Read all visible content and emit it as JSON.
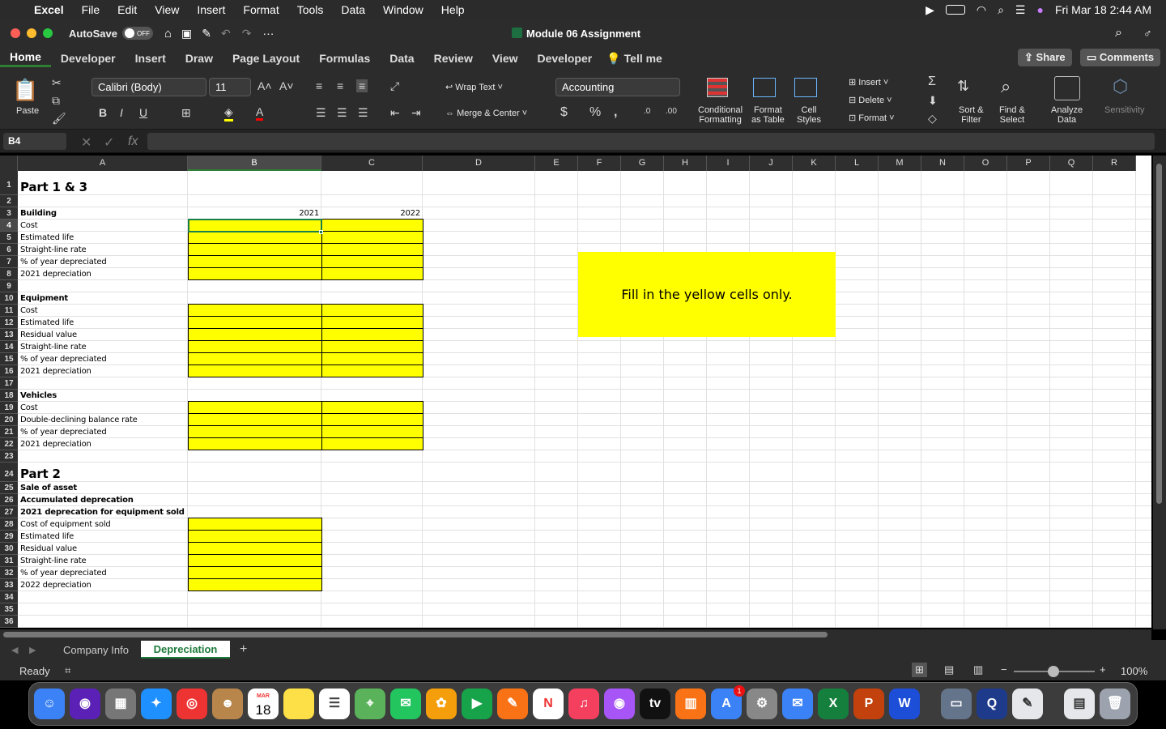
{
  "menubar": {
    "apple": "",
    "app": "Excel",
    "items": [
      "File",
      "Edit",
      "View",
      "Insert",
      "Format",
      "Tools",
      "Data",
      "Window",
      "Help"
    ],
    "datetime": "Fri Mar 18  2:44 AM"
  },
  "titlebar": {
    "autosave": "AutoSave",
    "autosave_state": "OFF",
    "title": "Module 06 Assignment"
  },
  "ribbon_tabs": [
    "Home",
    "Developer",
    "Insert",
    "Draw",
    "Page Layout",
    "Formulas",
    "Data",
    "Review",
    "View",
    "Developer"
  ],
  "tell_me": "Tell me",
  "share": "Share",
  "comments": "Comments",
  "ribbon": {
    "paste": "Paste",
    "font": "Calibri (Body)",
    "size": "11",
    "wrap": "Wrap Text",
    "merge": "Merge & Center",
    "number_format": "Accounting",
    "cond1": "Conditional",
    "cond2": "Formatting",
    "fmt1": "Format",
    "fmt2": "as Table",
    "cell1": "Cell",
    "cell2": "Styles",
    "insert": "Insert",
    "delete": "Delete",
    "format": "Format",
    "sort1": "Sort &",
    "sort2": "Filter",
    "find1": "Find &",
    "find2": "Select",
    "analyze1": "Analyze",
    "analyze2": "Data",
    "sensitivity": "Sensitivity"
  },
  "namebox": "B4",
  "fx": "fx",
  "columns": [
    "A",
    "B",
    "C",
    "D",
    "E",
    "F",
    "G",
    "H",
    "I",
    "J",
    "K",
    "L",
    "M",
    "N",
    "O",
    "P",
    "Q",
    "R"
  ],
  "rows": [
    {
      "n": "1",
      "a": "Part 1 & 3"
    },
    {
      "n": "2",
      "a": ""
    },
    {
      "n": "3",
      "a": "Building",
      "b": "2021",
      "c": "2022"
    },
    {
      "n": "4",
      "a": "Cost"
    },
    {
      "n": "5",
      "a": "Estimated life"
    },
    {
      "n": "6",
      "a": "Straight-line rate"
    },
    {
      "n": "7",
      "a": "% of year depreciated"
    },
    {
      "n": "8",
      "a": "2021 depreciation"
    },
    {
      "n": "9",
      "a": ""
    },
    {
      "n": "10",
      "a": "Equipment"
    },
    {
      "n": "11",
      "a": "Cost"
    },
    {
      "n": "12",
      "a": "Estimated life"
    },
    {
      "n": "13",
      "a": "Residual value"
    },
    {
      "n": "14",
      "a": "Straight-line rate"
    },
    {
      "n": "15",
      "a": "% of year depreciated"
    },
    {
      "n": "16",
      "a": "2021 depreciation"
    },
    {
      "n": "17",
      "a": ""
    },
    {
      "n": "18",
      "a": "Vehicles"
    },
    {
      "n": "19",
      "a": "Cost"
    },
    {
      "n": "20",
      "a": "Double-declining balance rate"
    },
    {
      "n": "21",
      "a": "% of year depreciated"
    },
    {
      "n": "22",
      "a": "2021 depreciation"
    },
    {
      "n": "23",
      "a": ""
    },
    {
      "n": "24",
      "a": "Part 2"
    },
    {
      "n": "25",
      "a": "Sale of asset"
    },
    {
      "n": "26",
      "a": "Accumulated deprecation"
    },
    {
      "n": "27",
      "a": "2021 deprecation for equipment sold"
    },
    {
      "n": "28",
      "a": "Cost of equipment sold"
    },
    {
      "n": "29",
      "a": "Estimated life"
    },
    {
      "n": "30",
      "a": "Residual value"
    },
    {
      "n": "31",
      "a": "Straight-line rate"
    },
    {
      "n": "32",
      "a": "% of year depreciated"
    },
    {
      "n": "33",
      "a": "2022 depreciation"
    },
    {
      "n": "34",
      "a": ""
    },
    {
      "n": "35",
      "a": ""
    },
    {
      "n": "36",
      "a": ""
    }
  ],
  "note": "Fill in the yellow cells only.",
  "sheet_tabs": [
    "Company Info",
    "Depreciation"
  ],
  "status": "Ready",
  "zoom": "100%",
  "dock_calendar_month": "MAR",
  "dock_calendar_day": "18",
  "dock_badge": "1",
  "dock_tv": "tv"
}
